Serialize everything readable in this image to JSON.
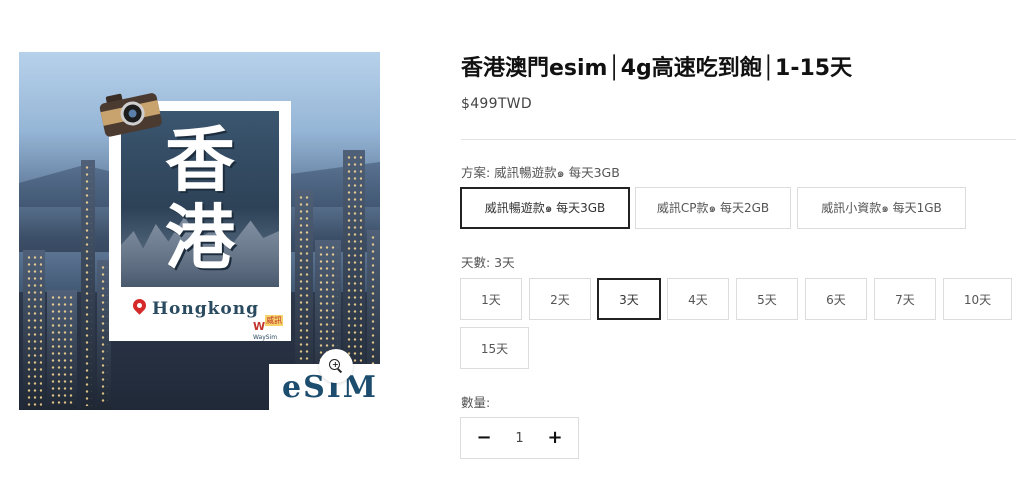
{
  "image": {
    "big_char_1": "香",
    "big_char_2": "港",
    "location": "Hongkong",
    "logo_mark": "W",
    "logo_cn": "威訊",
    "logo_text": "WaySim",
    "esim_label": "eSIM"
  },
  "product": {
    "title": "香港澳門esim│4g高速吃到飽│1-15天",
    "price": "$499TWD"
  },
  "plan": {
    "label": "方案: 威訊暢遊款๑ 每天3GB",
    "options": [
      {
        "label": "威訊暢遊款๑ 每天3GB",
        "selected": true
      },
      {
        "label": "威訊CP款๑ 每天2GB",
        "selected": false
      },
      {
        "label": "威訊小資款๑ 每天1GB",
        "selected": false
      }
    ]
  },
  "days": {
    "label": "天數: 3天",
    "options": [
      {
        "label": "1天",
        "selected": false
      },
      {
        "label": "2天",
        "selected": false
      },
      {
        "label": "3天",
        "selected": true
      },
      {
        "label": "4天",
        "selected": false
      },
      {
        "label": "5天",
        "selected": false
      },
      {
        "label": "6天",
        "selected": false
      },
      {
        "label": "7天",
        "selected": false
      },
      {
        "label": "10天",
        "selected": false
      },
      {
        "label": "15天",
        "selected": false
      }
    ]
  },
  "quantity": {
    "label": "數量:",
    "value": "1",
    "decrement": "−",
    "increment": "+"
  }
}
